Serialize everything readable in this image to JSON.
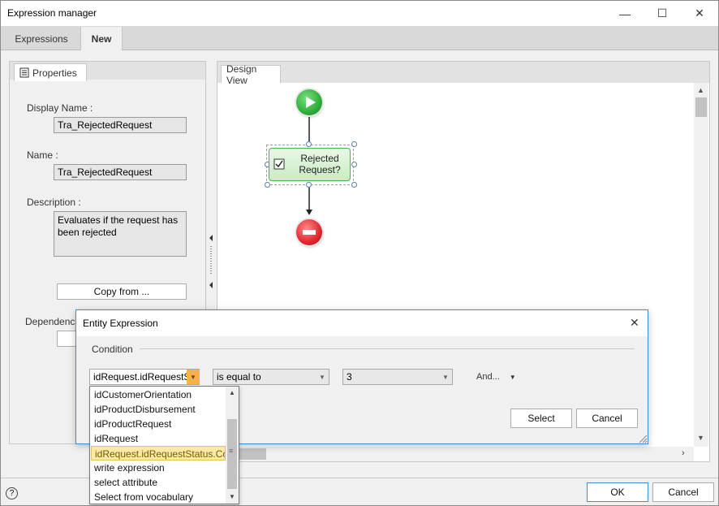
{
  "window": {
    "title": "Expression manager",
    "minimize": "—",
    "maximize": "☐",
    "close": "✕"
  },
  "tabs": [
    {
      "label": "Expressions"
    },
    {
      "label": "New"
    }
  ],
  "properties": {
    "tab_label": "Properties",
    "display_name_label": "Display Name :",
    "display_name_value": "Tra_RejectedRequest",
    "name_label": "Name :",
    "name_value": "Tra_RejectedRequest",
    "description_label": "Description :",
    "description_value": "Evaluates if the request has been rejected",
    "copy_button": "Copy from ...",
    "dependencies_label": "Dependencies"
  },
  "design_view": {
    "tab_label": "Design View",
    "node_label": "Rejected Request?"
  },
  "dialog": {
    "title": "Entity Expression",
    "close": "✕",
    "condition_label": "Condition",
    "attribute_value": "idRequest.idRequestS",
    "operator_value": "is equal to",
    "comparison_value": "3",
    "and_label": "And...",
    "select_button": "Select",
    "cancel_button": "Cancel",
    "dropdown_items": [
      {
        "label": "idCustomerOrientation"
      },
      {
        "label": "idProductDisbursement"
      },
      {
        "label": "idProductRequest"
      },
      {
        "label": "idRequest"
      },
      {
        "label": "idRequest.idRequestStatus.Co"
      },
      {
        "label": "write expression"
      },
      {
        "label": "select attribute"
      },
      {
        "label": "Select from vocabulary"
      }
    ]
  },
  "footer": {
    "help": "?",
    "ok_button": "OK",
    "cancel_button": "Cancel"
  },
  "colors": {
    "accent": "#3c8fd6",
    "start_green": "#2fae3a",
    "stop_red": "#e0282e",
    "selected_item": "#fbe9a6"
  }
}
